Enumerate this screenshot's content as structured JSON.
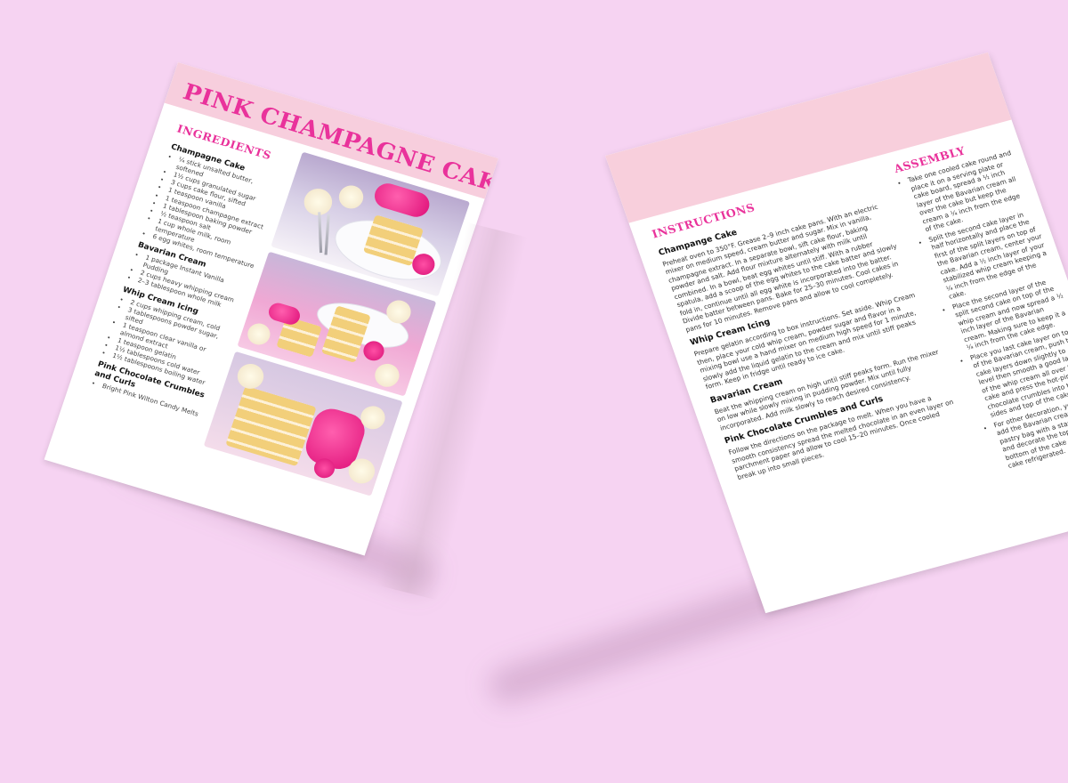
{
  "colors": {
    "background": "#f6d3f2",
    "accent": "#e9329b",
    "header_band": "#f7cedd",
    "page": "#ffffff"
  },
  "left_page": {
    "title": "Pink Champagne Cake",
    "ingredients_heading": "INGREDIENTS",
    "groups": [
      {
        "name": "Champagne Cake",
        "items": [
          "¼ stick unsalted butter, softened",
          "1½ cups granulated sugar",
          "3 cups cake flour, sifted",
          "1 teaspoon vanilla",
          "1 teaspoon champagne extract",
          "1 tablespoon baking powder",
          "½ teaspoon salt",
          "1 cup whole milk, room temperature",
          "6 egg whites, room temperature"
        ]
      },
      {
        "name": "Bavarian Cream",
        "items": [
          "1 package Instant Vanilla Pudding",
          "2 cups heavy whipping cream",
          "2–3 tablespoon whole milk"
        ]
      },
      {
        "name": "Whip Cream Icing",
        "items": [
          "2 cups whipping cream, cold",
          "3 tablespoons powder sugar, sifted",
          "1 teaspoon clear vanilla or almond extract",
          "1 teaspoon gelatin",
          "1½ tablespoons cold water",
          "1½ tablespoons boiling water"
        ]
      },
      {
        "name": "Pink Chocolate Crumbles and Curls",
        "items": [
          "Bright Pink Wilton Candy Melts"
        ]
      }
    ]
  },
  "right_page": {
    "instructions_heading": "INSTRUCTIONS",
    "assembly_heading": "ASSEMBLY",
    "sections": [
      {
        "name": "Champange Cake",
        "text": "Preheat oven to 350°F. Grease 2–9 inch cake pans. With an electric mixer on medium speed, cream butter and sugar. Mix in vanilla, champagne extract. In a separate bowl, sift cake flour, baking powder and salt. Add flour mixture alternately with milk until combined. In a bowl, beat egg whites until stiff. With a rubber spatula, add a scoop of the egg whites to the cake batter and slowly fold in, continue until all egg white is incorporated into the batter. Divide batter between pans. Bake for 25–30 minutes. Cool cakes in pans for 10 minutes. Remove pans and allow to cool completely."
      },
      {
        "name": "Whip Cream Icing",
        "text": "Prepare gelatin according to box instructions. Set aside. Whip Cream then, place your cold whip cream, powder sugar and flavor in a mixing bowl use a hand mixer on medium high speed for 1 minute, slowly add the liquid gelatin to the cream and mix until stiff peaks form. Keep in fridge until ready to ice cake."
      },
      {
        "name": "Bavarian Cream",
        "text": "Beat the whipping cream on high until stiff peaks form. Run the mixer on low while slowly mixing in pudding powder. Mix until fully incorporated. Add milk slowly to reach desired consistency."
      },
      {
        "name": "Pink Chocolate Crumbles and Curls",
        "text": "Follow the directions on the package to melt. When you have a smooth consistency spread the melted chocolate in an even layer on parchment paper and allow to cool 15–20 minutes. Once cooled break up into small pieces."
      }
    ],
    "assembly_steps": [
      "Take one cooled cake round and place it on a serving plate or cake board, spread a ½ inch layer of the Bavarian cream all over the cake but keep the cream a ¼ inch from the edge of the cake.",
      "Split the second cake layer in half horizontally and place the first of the split layers on top of the Bavarian cream, center your cake. Add a ½ inch layer of your stabilized whip cream keeping a ¼ inch from the edge of the cake.",
      "Place the second layer of the split second cake on top of the whip cream and now spread a ½ inch layer of the Bavarian cream. Making sure to keep it a ¼ inch from the cake edge.",
      "Place you last cake layer on top of the Bavarian cream, push the cake layers down slightly to level then smooth a good layer of the whip cream all over the cake and press the hot-pink chocolate crumbles into the sides and top of the cake.",
      "For other decoration, you can add the Bavarian cream to a pastry bag with a star tip nozzle and decorate the top and bottom of the cake base. Keep cake refrigerated."
    ]
  }
}
